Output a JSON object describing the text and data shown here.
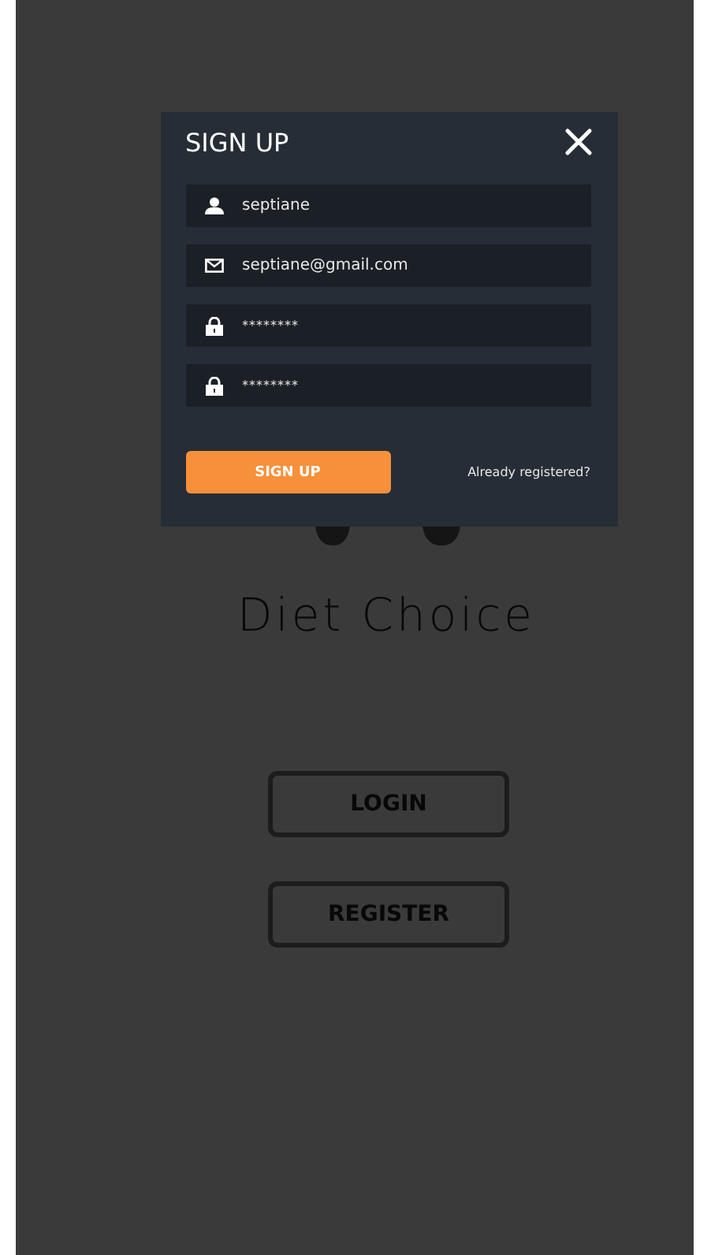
{
  "dialog": {
    "title": "SIGN UP",
    "fields": [
      {
        "kind": "user",
        "value": "septiane"
      },
      {
        "kind": "email",
        "value": "septiane@gmail.com"
      },
      {
        "kind": "password",
        "value": "********"
      },
      {
        "kind": "password",
        "value": "********"
      }
    ],
    "submit": "SIGN UP",
    "link": "Already registered?"
  },
  "background": {
    "app_name": "Diet Choice",
    "buttons": [
      "LOGIN",
      "REGISTER"
    ]
  }
}
